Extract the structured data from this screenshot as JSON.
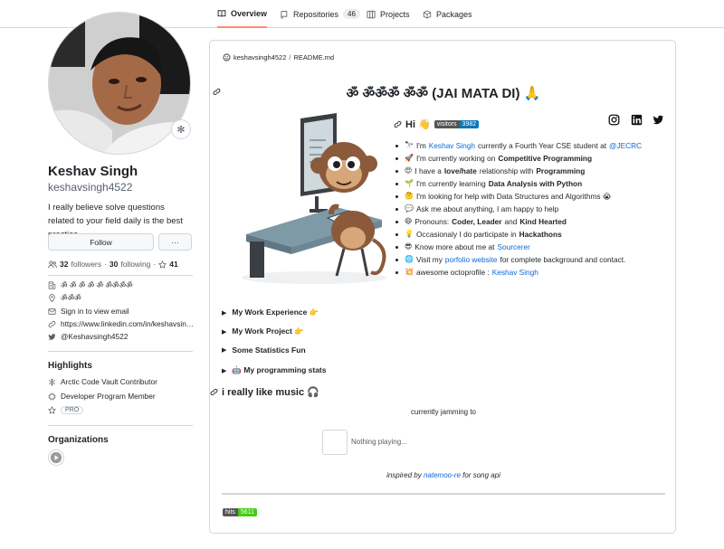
{
  "tabs": [
    {
      "label": "Overview",
      "active": true,
      "icon": "book-icon"
    },
    {
      "label": "Repositories",
      "count": "46",
      "icon": "repo-icon"
    },
    {
      "label": "Projects",
      "icon": "table-icon"
    },
    {
      "label": "Packages",
      "icon": "package-icon"
    }
  ],
  "profile": {
    "fullname": "Keshav Singh",
    "login": "keshavsingh4522",
    "bio": "I really believe solve questions related to your field daily is the best practice.",
    "follow_label": "Follow",
    "more_label": "···",
    "followers_count": "32",
    "followers_label": "followers",
    "following_count": "30",
    "following_label": "following",
    "stars_count": "41",
    "status_emoji": "✻",
    "details": [
      {
        "icon": "organization-icon",
        "text": "ॐ ॐ ॐ ॐ ॐ ॐॐॐॐ"
      },
      {
        "icon": "location-icon",
        "text": "ॐॐॐ"
      },
      {
        "icon": "mail-icon",
        "text": "Sign in to view email"
      },
      {
        "icon": "link-icon",
        "text": "https://www.linkedin.com/in/keshavsin…"
      },
      {
        "icon": "twitter-icon",
        "text": "@Keshavsingh4522"
      }
    ]
  },
  "highlights": {
    "title": "Highlights",
    "items": [
      {
        "icon": "snowflake-icon",
        "text": "Arctic Code Vault Contributor"
      },
      {
        "icon": "cpu-icon",
        "text": "Developer Program Member"
      },
      {
        "icon": "star-icon",
        "text": "PRO"
      }
    ]
  },
  "organizations": {
    "title": "Organizations"
  },
  "readme": {
    "path_user": "keshavsingh4522",
    "path_sep": "/",
    "path_file": "README.md",
    "title": "ॐ ॐॐॐ ॐॐ (JAI MATA DI) 🙏",
    "hi": "Hi 👋",
    "visitors_label": "visitors",
    "visitors_count": "3982",
    "bullets": [
      {
        "emoji": "🔭",
        "pre": "I'm ",
        "link": "Keshav Singh",
        "post": " currently a Fourth Year CSE student at ",
        "link2": "@JECRC"
      },
      {
        "emoji": "🚀",
        "pre": "I'm currently working on ",
        "bold": "Competitive Programming"
      },
      {
        "emoji": "😍",
        "pre": "I have a ",
        "bold": "love/hate",
        "post": " relationship with ",
        "bold2": "Programming"
      },
      {
        "emoji": "🌱",
        "pre": "I'm currently learning ",
        "bold": "Data Analysis with Python"
      },
      {
        "emoji": "🤔",
        "pre": "I'm looking for help with Data Structures and Algorithms 😭"
      },
      {
        "emoji": "💬",
        "pre": "Ask me about anything, I am happy to help"
      },
      {
        "emoji": "😄",
        "pre": "Pronouns: ",
        "bold": "Coder, Leader",
        "post": " and ",
        "bold2": "Kind Hearted"
      },
      {
        "emoji": "💡",
        "pre": "Occasionaly I do participate in ",
        "bold": "Hackathons"
      },
      {
        "emoji": "😎",
        "pre": "Know more about me at ",
        "link": "Sourcerer"
      },
      {
        "emoji": "🌐",
        "pre": "Visit my ",
        "link": "porfolio website",
        "post": " for complete background and contact."
      },
      {
        "emoji": "💥",
        "pre": "awesome octoprofile : ",
        "link": "Keshav Singh"
      }
    ],
    "sections": [
      {
        "label": "My Work Experience 👉"
      },
      {
        "label": "My Work Project 👉"
      },
      {
        "label": "Some Statistics Fun"
      },
      {
        "label": "🤖 My programming stats"
      }
    ],
    "music_title": "i really like music 🎧",
    "jamming": "currently jamming to",
    "nothing_playing": "Nothing playing...",
    "inspired_pre": "inspired by ",
    "inspired_link": "natemoo-re",
    "inspired_post": " for song api",
    "hits_label": "hits",
    "hits_count": "5611"
  },
  "colors": {
    "accent": "#0969da",
    "tab_underline": "#fd8c73",
    "badge_blue": "#0e75b6",
    "badge_green": "#44cc11"
  }
}
